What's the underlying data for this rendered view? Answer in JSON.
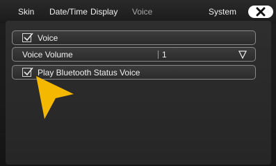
{
  "tabs": [
    {
      "label": "Skin"
    },
    {
      "label": "Date/Time"
    },
    {
      "label": "Display"
    },
    {
      "label": "Voice"
    },
    {
      "label": "System"
    }
  ],
  "active_tab": "Voice",
  "close_icon": "close-icon",
  "settings": {
    "voice": {
      "label": "Voice",
      "checked": true
    },
    "voice_volume": {
      "label": "Voice Volume",
      "value": "1"
    },
    "bt_status_voice": {
      "label": "Play Bluetooth Status Voice",
      "checked": true
    }
  },
  "colors": {
    "pointer": "#f5b800",
    "background": "#1a1a1a",
    "row_border": "#8a8a8a"
  }
}
